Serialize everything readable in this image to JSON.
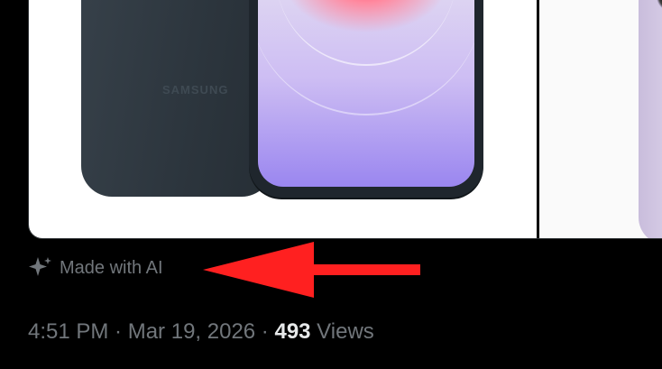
{
  "media": {
    "brand_text": "SAMSUNG"
  },
  "ai_label": {
    "text": "Made with AI",
    "icon": "sparkle-icon"
  },
  "annotation": {
    "arrow_color": "#ff2020"
  },
  "meta": {
    "time": "4:51 PM",
    "separator1": " · ",
    "date": "Mar 19, 2026",
    "separator2": " · ",
    "views_count": "493",
    "views_label": " Views"
  }
}
